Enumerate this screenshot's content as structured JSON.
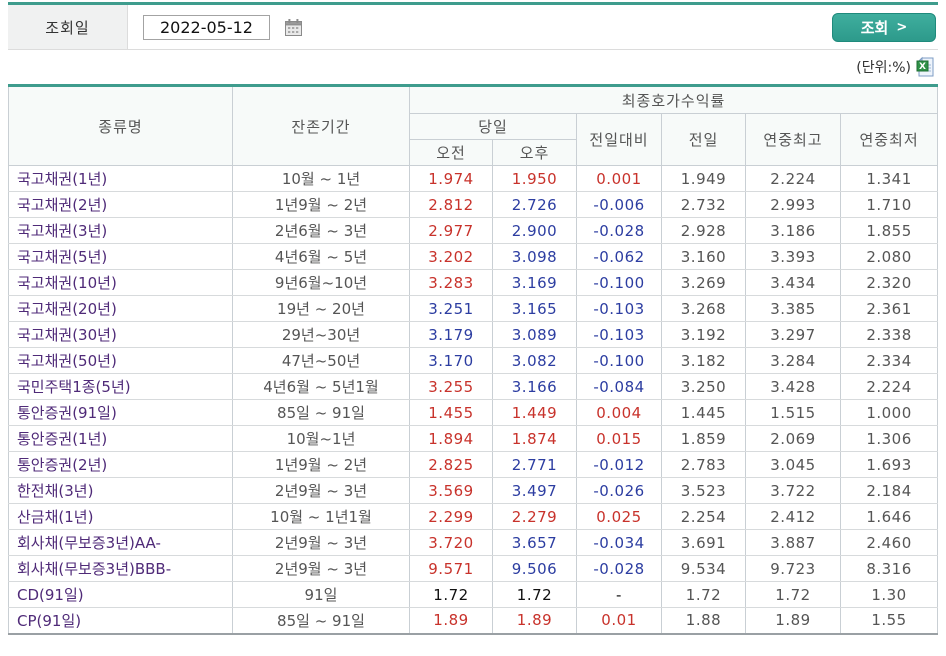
{
  "filter": {
    "label": "조회일",
    "date_value": "2022-05-12",
    "search_label": "조회",
    "search_arrow": ">"
  },
  "units_note": "(단위:%)",
  "icons": {
    "calendar": "calendar-icon",
    "excel": "excel-download-icon"
  },
  "colors": {
    "up": "#c8322b",
    "down": "#2c3da1",
    "name": "#4f2a78",
    "accent": "#2d9a8b",
    "accent_dark": "#3e9c8d"
  },
  "table": {
    "header": {
      "col_name": "종류명",
      "col_period": "잔존기간",
      "group_yield": "최종호가수익률",
      "group_today": "당일",
      "col_am": "오전",
      "col_pm": "오후",
      "col_diff": "전일대비",
      "col_prev": "전일",
      "col_high": "연중최고",
      "col_low": "연중최저"
    },
    "rows": [
      {
        "name": "국고채권(1년)",
        "period": "10월 ~ 1년",
        "am": {
          "v": "1.974",
          "c": "up"
        },
        "pm": {
          "v": "1.950",
          "c": "up"
        },
        "diff": {
          "v": "0.001",
          "c": "up"
        },
        "prev": "1.949",
        "high": "2.224",
        "low": "1.341"
      },
      {
        "name": "국고채권(2년)",
        "period": "1년9월 ~ 2년",
        "am": {
          "v": "2.812",
          "c": "up"
        },
        "pm": {
          "v": "2.726",
          "c": "down"
        },
        "diff": {
          "v": "-0.006",
          "c": "down"
        },
        "prev": "2.732",
        "high": "2.993",
        "low": "1.710"
      },
      {
        "name": "국고채권(3년)",
        "period": "2년6월 ~ 3년",
        "am": {
          "v": "2.977",
          "c": "up"
        },
        "pm": {
          "v": "2.900",
          "c": "down"
        },
        "diff": {
          "v": "-0.028",
          "c": "down"
        },
        "prev": "2.928",
        "high": "3.186",
        "low": "1.855"
      },
      {
        "name": "국고채권(5년)",
        "period": "4년6월 ~ 5년",
        "am": {
          "v": "3.202",
          "c": "up"
        },
        "pm": {
          "v": "3.098",
          "c": "down"
        },
        "diff": {
          "v": "-0.062",
          "c": "down"
        },
        "prev": "3.160",
        "high": "3.393",
        "low": "2.080"
      },
      {
        "name": "국고채권(10년)",
        "period": "9년6월~10년",
        "am": {
          "v": "3.283",
          "c": "up"
        },
        "pm": {
          "v": "3.169",
          "c": "down"
        },
        "diff": {
          "v": "-0.100",
          "c": "down"
        },
        "prev": "3.269",
        "high": "3.434",
        "low": "2.320"
      },
      {
        "name": "국고채권(20년)",
        "period": "19년 ~ 20년",
        "am": {
          "v": "3.251",
          "c": "down"
        },
        "pm": {
          "v": "3.165",
          "c": "down"
        },
        "diff": {
          "v": "-0.103",
          "c": "down"
        },
        "prev": "3.268",
        "high": "3.385",
        "low": "2.361"
      },
      {
        "name": "국고채권(30년)",
        "period": "29년~30년",
        "am": {
          "v": "3.179",
          "c": "down"
        },
        "pm": {
          "v": "3.089",
          "c": "down"
        },
        "diff": {
          "v": "-0.103",
          "c": "down"
        },
        "prev": "3.192",
        "high": "3.297",
        "low": "2.338"
      },
      {
        "name": "국고채권(50년)",
        "period": "47년~50년",
        "am": {
          "v": "3.170",
          "c": "down"
        },
        "pm": {
          "v": "3.082",
          "c": "down"
        },
        "diff": {
          "v": "-0.100",
          "c": "down"
        },
        "prev": "3.182",
        "high": "3.284",
        "low": "2.334"
      },
      {
        "name": "국민주택1종(5년)",
        "period": "4년6월 ~ 5년1월",
        "am": {
          "v": "3.255",
          "c": "up"
        },
        "pm": {
          "v": "3.166",
          "c": "down"
        },
        "diff": {
          "v": "-0.084",
          "c": "down"
        },
        "prev": "3.250",
        "high": "3.428",
        "low": "2.224"
      },
      {
        "name": "통안증권(91일)",
        "period": "85일 ~ 91일",
        "am": {
          "v": "1.455",
          "c": "up"
        },
        "pm": {
          "v": "1.449",
          "c": "up"
        },
        "diff": {
          "v": "0.004",
          "c": "up"
        },
        "prev": "1.445",
        "high": "1.515",
        "low": "1.000"
      },
      {
        "name": "통안증권(1년)",
        "period": "10월~1년",
        "am": {
          "v": "1.894",
          "c": "up"
        },
        "pm": {
          "v": "1.874",
          "c": "up"
        },
        "diff": {
          "v": "0.015",
          "c": "up"
        },
        "prev": "1.859",
        "high": "2.069",
        "low": "1.306"
      },
      {
        "name": "통안증권(2년)",
        "period": "1년9월 ~ 2년",
        "am": {
          "v": "2.825",
          "c": "up"
        },
        "pm": {
          "v": "2.771",
          "c": "down"
        },
        "diff": {
          "v": "-0.012",
          "c": "down"
        },
        "prev": "2.783",
        "high": "3.045",
        "low": "1.693"
      },
      {
        "name": "한전채(3년)",
        "period": "2년9월 ~ 3년",
        "am": {
          "v": "3.569",
          "c": "up"
        },
        "pm": {
          "v": "3.497",
          "c": "down"
        },
        "diff": {
          "v": "-0.026",
          "c": "down"
        },
        "prev": "3.523",
        "high": "3.722",
        "low": "2.184"
      },
      {
        "name": "산금채(1년)",
        "period": "10월 ~ 1년1월",
        "am": {
          "v": "2.299",
          "c": "up"
        },
        "pm": {
          "v": "2.279",
          "c": "up"
        },
        "diff": {
          "v": "0.025",
          "c": "up"
        },
        "prev": "2.254",
        "high": "2.412",
        "low": "1.646"
      },
      {
        "name": "회사채(무보증3년)AA-",
        "period": "2년9월 ~ 3년",
        "am": {
          "v": "3.720",
          "c": "up"
        },
        "pm": {
          "v": "3.657",
          "c": "down"
        },
        "diff": {
          "v": "-0.034",
          "c": "down"
        },
        "prev": "3.691",
        "high": "3.887",
        "low": "2.460"
      },
      {
        "name": "회사채(무보증3년)BBB-",
        "period": "2년9월 ~ 3년",
        "am": {
          "v": "9.571",
          "c": "up"
        },
        "pm": {
          "v": "9.506",
          "c": "down"
        },
        "diff": {
          "v": "-0.028",
          "c": "down"
        },
        "prev": "9.534",
        "high": "9.723",
        "low": "8.316"
      },
      {
        "name": "CD(91일)",
        "period": "91일",
        "am": {
          "v": "1.72",
          "c": "flat"
        },
        "pm": {
          "v": "1.72",
          "c": "flat"
        },
        "diff": {
          "v": "-",
          "c": "flat"
        },
        "prev": "1.72",
        "high": "1.72",
        "low": "1.30"
      },
      {
        "name": "CP(91일)",
        "period": "85일 ~ 91일",
        "am": {
          "v": "1.89",
          "c": "up"
        },
        "pm": {
          "v": "1.89",
          "c": "up"
        },
        "diff": {
          "v": "0.01",
          "c": "up"
        },
        "prev": "1.88",
        "high": "1.89",
        "low": "1.55"
      }
    ]
  }
}
